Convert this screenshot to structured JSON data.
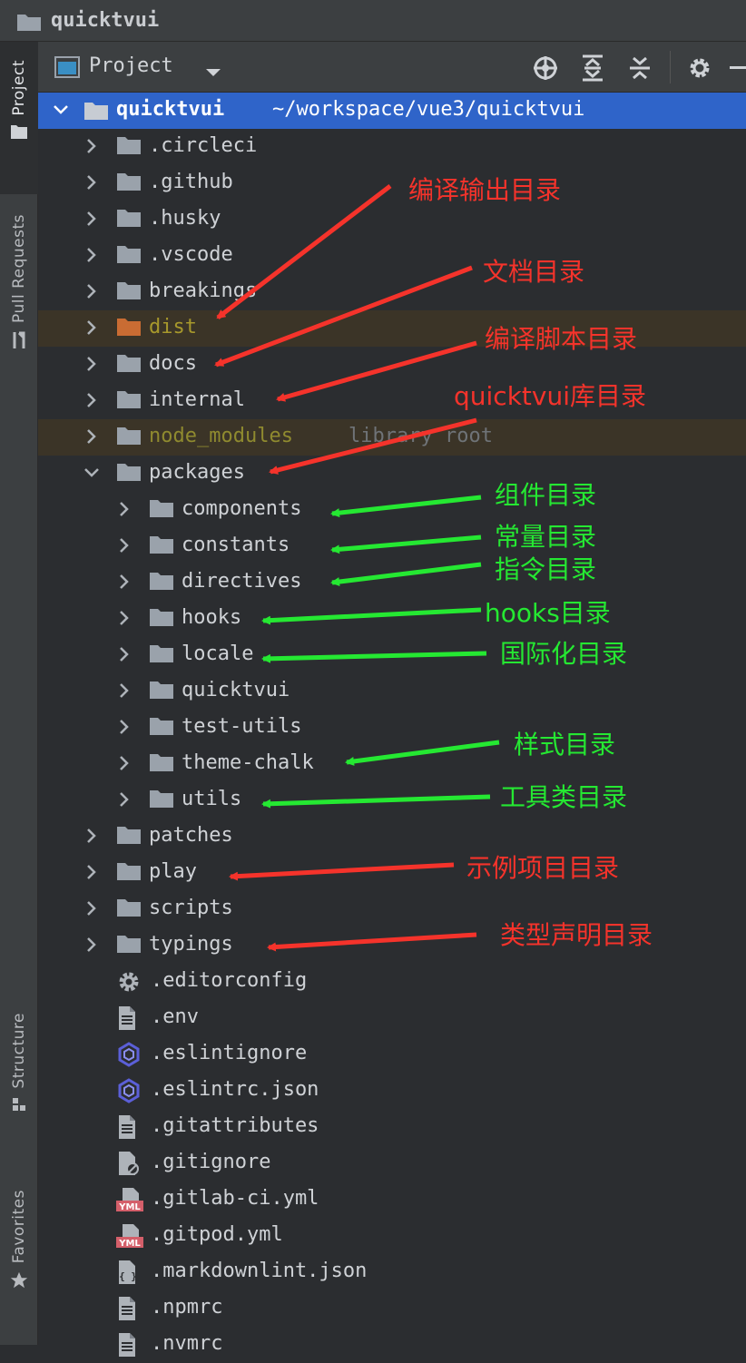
{
  "window": {
    "title": "quicktvui"
  },
  "side_tabs": [
    {
      "label": "Project"
    },
    {
      "label": "Pull Requests"
    },
    {
      "label": "Structure"
    },
    {
      "label": "Favorites"
    }
  ],
  "toolbar": {
    "view_label": "Project",
    "icons": [
      "locate-icon",
      "expand-all-icon",
      "collapse-all-icon",
      "gear-icon"
    ]
  },
  "tree": {
    "root": {
      "name": "quicktvui",
      "path": "~/workspace/vue3/quicktvui"
    },
    "items": [
      {
        "name": ".circleci",
        "kind": "folder",
        "level": 1,
        "state": "collapsed"
      },
      {
        "name": ".github",
        "kind": "folder",
        "level": 1,
        "state": "collapsed"
      },
      {
        "name": ".husky",
        "kind": "folder",
        "level": 1,
        "state": "collapsed"
      },
      {
        "name": ".vscode",
        "kind": "folder",
        "level": 1,
        "state": "collapsed"
      },
      {
        "name": "breakings",
        "kind": "folder",
        "level": 1,
        "state": "collapsed"
      },
      {
        "name": "dist",
        "kind": "folder-excluded",
        "level": 1,
        "state": "collapsed"
      },
      {
        "name": "docs",
        "kind": "folder",
        "level": 1,
        "state": "collapsed"
      },
      {
        "name": "internal",
        "kind": "folder",
        "level": 1,
        "state": "collapsed"
      },
      {
        "name": "node_modules",
        "suffix": "library root",
        "kind": "folder-library",
        "level": 1,
        "state": "collapsed"
      },
      {
        "name": "packages",
        "kind": "folder",
        "level": 1,
        "state": "expanded"
      },
      {
        "name": "components",
        "kind": "folder",
        "level": 2,
        "state": "collapsed"
      },
      {
        "name": "constants",
        "kind": "folder",
        "level": 2,
        "state": "collapsed"
      },
      {
        "name": "directives",
        "kind": "folder",
        "level": 2,
        "state": "collapsed"
      },
      {
        "name": "hooks",
        "kind": "folder",
        "level": 2,
        "state": "collapsed"
      },
      {
        "name": "locale",
        "kind": "folder",
        "level": 2,
        "state": "collapsed"
      },
      {
        "name": "quicktvui",
        "kind": "folder",
        "level": 2,
        "state": "collapsed"
      },
      {
        "name": "test-utils",
        "kind": "folder",
        "level": 2,
        "state": "collapsed"
      },
      {
        "name": "theme-chalk",
        "kind": "folder",
        "level": 2,
        "state": "collapsed"
      },
      {
        "name": "utils",
        "kind": "folder",
        "level": 2,
        "state": "collapsed"
      },
      {
        "name": "patches",
        "kind": "folder",
        "level": 1,
        "state": "collapsed"
      },
      {
        "name": "play",
        "kind": "folder",
        "level": 1,
        "state": "collapsed"
      },
      {
        "name": "scripts",
        "kind": "folder",
        "level": 1,
        "state": "collapsed"
      },
      {
        "name": "typings",
        "kind": "folder",
        "level": 1,
        "state": "collapsed"
      },
      {
        "name": ".editorconfig",
        "kind": "gear-file",
        "level": 1
      },
      {
        "name": ".env",
        "kind": "text-file",
        "level": 1
      },
      {
        "name": ".eslintignore",
        "kind": "eslint-file",
        "level": 1
      },
      {
        "name": ".eslintrc.json",
        "kind": "eslint-file",
        "level": 1
      },
      {
        "name": ".gitattributes",
        "kind": "text-file",
        "level": 1
      },
      {
        "name": ".gitignore",
        "kind": "ignore-file",
        "level": 1
      },
      {
        "name": ".gitlab-ci.yml",
        "kind": "yml-file",
        "level": 1
      },
      {
        "name": ".gitpod.yml",
        "kind": "yml-file",
        "level": 1
      },
      {
        "name": ".markdownlint.json",
        "kind": "json-file",
        "level": 1
      },
      {
        "name": ".npmrc",
        "kind": "text-file",
        "level": 1
      },
      {
        "name": ".nvmrc",
        "kind": "text-file",
        "level": 1
      }
    ]
  },
  "annotations": [
    {
      "text": "编译输出目录",
      "color": "red",
      "target": "dist"
    },
    {
      "text": "文档目录",
      "color": "red",
      "target": "docs"
    },
    {
      "text": "编译脚本目录",
      "color": "red",
      "target": "internal"
    },
    {
      "text": "quicktvui库目录",
      "color": "red",
      "target": "packages"
    },
    {
      "text": "组件目录",
      "color": "green",
      "target": "components"
    },
    {
      "text": "常量目录",
      "color": "green",
      "target": "constants"
    },
    {
      "text": "指令目录",
      "color": "green",
      "target": "directives"
    },
    {
      "text": "hooks目录",
      "color": "green",
      "target": "hooks"
    },
    {
      "text": "国际化目录",
      "color": "green",
      "target": "locale"
    },
    {
      "text": "样式目录",
      "color": "green",
      "target": "theme-chalk"
    },
    {
      "text": "工具类目录",
      "color": "green",
      "target": "utils"
    },
    {
      "text": "示例项目目录",
      "color": "red",
      "target": "play"
    },
    {
      "text": "类型声明目录",
      "color": "red",
      "target": "typings"
    }
  ],
  "colors": {
    "selection": "#2f64c9",
    "annotation_red": "#f5332b",
    "annotation_green": "#25e832",
    "folder": "#9aa2ab",
    "folder_excluded": "#c96c33"
  }
}
